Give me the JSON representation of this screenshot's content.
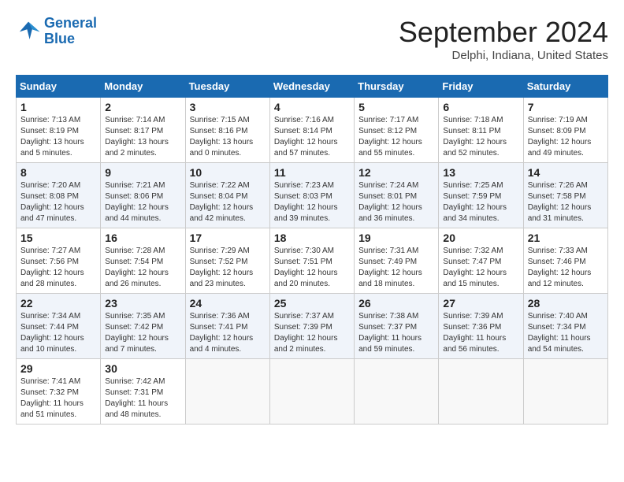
{
  "logo": {
    "line1": "General",
    "line2": "Blue"
  },
  "title": "September 2024",
  "location": "Delphi, Indiana, United States",
  "days_header": [
    "Sunday",
    "Monday",
    "Tuesday",
    "Wednesday",
    "Thursday",
    "Friday",
    "Saturday"
  ],
  "weeks": [
    [
      {
        "day": "1",
        "sunrise": "7:13 AM",
        "sunset": "8:19 PM",
        "daylight": "13 hours and 5 minutes."
      },
      {
        "day": "2",
        "sunrise": "7:14 AM",
        "sunset": "8:17 PM",
        "daylight": "13 hours and 2 minutes."
      },
      {
        "day": "3",
        "sunrise": "7:15 AM",
        "sunset": "8:16 PM",
        "daylight": "13 hours and 0 minutes."
      },
      {
        "day": "4",
        "sunrise": "7:16 AM",
        "sunset": "8:14 PM",
        "daylight": "12 hours and 57 minutes."
      },
      {
        "day": "5",
        "sunrise": "7:17 AM",
        "sunset": "8:12 PM",
        "daylight": "12 hours and 55 minutes."
      },
      {
        "day": "6",
        "sunrise": "7:18 AM",
        "sunset": "8:11 PM",
        "daylight": "12 hours and 52 minutes."
      },
      {
        "day": "7",
        "sunrise": "7:19 AM",
        "sunset": "8:09 PM",
        "daylight": "12 hours and 49 minutes."
      }
    ],
    [
      {
        "day": "8",
        "sunrise": "7:20 AM",
        "sunset": "8:08 PM",
        "daylight": "12 hours and 47 minutes."
      },
      {
        "day": "9",
        "sunrise": "7:21 AM",
        "sunset": "8:06 PM",
        "daylight": "12 hours and 44 minutes."
      },
      {
        "day": "10",
        "sunrise": "7:22 AM",
        "sunset": "8:04 PM",
        "daylight": "12 hours and 42 minutes."
      },
      {
        "day": "11",
        "sunrise": "7:23 AM",
        "sunset": "8:03 PM",
        "daylight": "12 hours and 39 minutes."
      },
      {
        "day": "12",
        "sunrise": "7:24 AM",
        "sunset": "8:01 PM",
        "daylight": "12 hours and 36 minutes."
      },
      {
        "day": "13",
        "sunrise": "7:25 AM",
        "sunset": "7:59 PM",
        "daylight": "12 hours and 34 minutes."
      },
      {
        "day": "14",
        "sunrise": "7:26 AM",
        "sunset": "7:58 PM",
        "daylight": "12 hours and 31 minutes."
      }
    ],
    [
      {
        "day": "15",
        "sunrise": "7:27 AM",
        "sunset": "7:56 PM",
        "daylight": "12 hours and 28 minutes."
      },
      {
        "day": "16",
        "sunrise": "7:28 AM",
        "sunset": "7:54 PM",
        "daylight": "12 hours and 26 minutes."
      },
      {
        "day": "17",
        "sunrise": "7:29 AM",
        "sunset": "7:52 PM",
        "daylight": "12 hours and 23 minutes."
      },
      {
        "day": "18",
        "sunrise": "7:30 AM",
        "sunset": "7:51 PM",
        "daylight": "12 hours and 20 minutes."
      },
      {
        "day": "19",
        "sunrise": "7:31 AM",
        "sunset": "7:49 PM",
        "daylight": "12 hours and 18 minutes."
      },
      {
        "day": "20",
        "sunrise": "7:32 AM",
        "sunset": "7:47 PM",
        "daylight": "12 hours and 15 minutes."
      },
      {
        "day": "21",
        "sunrise": "7:33 AM",
        "sunset": "7:46 PM",
        "daylight": "12 hours and 12 minutes."
      }
    ],
    [
      {
        "day": "22",
        "sunrise": "7:34 AM",
        "sunset": "7:44 PM",
        "daylight": "12 hours and 10 minutes."
      },
      {
        "day": "23",
        "sunrise": "7:35 AM",
        "sunset": "7:42 PM",
        "daylight": "12 hours and 7 minutes."
      },
      {
        "day": "24",
        "sunrise": "7:36 AM",
        "sunset": "7:41 PM",
        "daylight": "12 hours and 4 minutes."
      },
      {
        "day": "25",
        "sunrise": "7:37 AM",
        "sunset": "7:39 PM",
        "daylight": "12 hours and 2 minutes."
      },
      {
        "day": "26",
        "sunrise": "7:38 AM",
        "sunset": "7:37 PM",
        "daylight": "11 hours and 59 minutes."
      },
      {
        "day": "27",
        "sunrise": "7:39 AM",
        "sunset": "7:36 PM",
        "daylight": "11 hours and 56 minutes."
      },
      {
        "day": "28",
        "sunrise": "7:40 AM",
        "sunset": "7:34 PM",
        "daylight": "11 hours and 54 minutes."
      }
    ],
    [
      {
        "day": "29",
        "sunrise": "7:41 AM",
        "sunset": "7:32 PM",
        "daylight": "11 hours and 51 minutes."
      },
      {
        "day": "30",
        "sunrise": "7:42 AM",
        "sunset": "7:31 PM",
        "daylight": "11 hours and 48 minutes."
      },
      null,
      null,
      null,
      null,
      null
    ]
  ]
}
